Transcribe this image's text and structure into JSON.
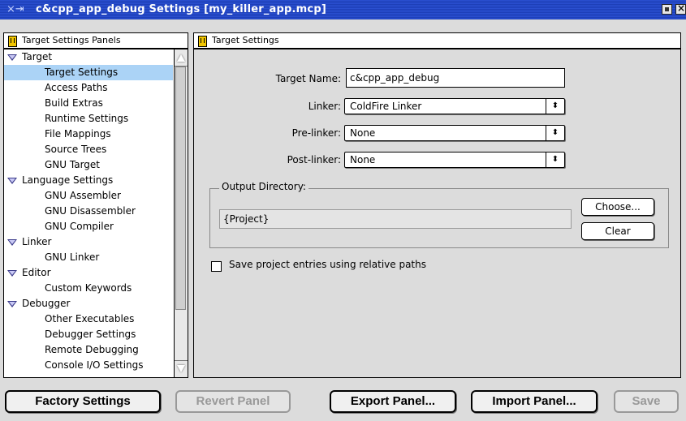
{
  "window": {
    "title": "c&cpp_app_debug Settings [my_killer_app.mcp]"
  },
  "left_panel": {
    "header": "Target Settings Panels",
    "tree": [
      {
        "label": "Target",
        "type": "group"
      },
      {
        "label": "Target Settings",
        "type": "item",
        "selected": true
      },
      {
        "label": "Access Paths",
        "type": "item"
      },
      {
        "label": "Build Extras",
        "type": "item"
      },
      {
        "label": "Runtime Settings",
        "type": "item"
      },
      {
        "label": "File Mappings",
        "type": "item"
      },
      {
        "label": "Source Trees",
        "type": "item"
      },
      {
        "label": "GNU Target",
        "type": "item"
      },
      {
        "label": "Language Settings",
        "type": "group"
      },
      {
        "label": "GNU Assembler",
        "type": "item"
      },
      {
        "label": "GNU Disassembler",
        "type": "item"
      },
      {
        "label": "GNU Compiler",
        "type": "item"
      },
      {
        "label": "Linker",
        "type": "group"
      },
      {
        "label": "GNU Linker",
        "type": "item"
      },
      {
        "label": "Editor",
        "type": "group"
      },
      {
        "label": "Custom Keywords",
        "type": "item"
      },
      {
        "label": "Debugger",
        "type": "group"
      },
      {
        "label": "Other Executables",
        "type": "item"
      },
      {
        "label": "Debugger Settings",
        "type": "item"
      },
      {
        "label": "Remote Debugging",
        "type": "item"
      },
      {
        "label": "Console I/O Settings",
        "type": "item"
      }
    ]
  },
  "right_panel": {
    "header": "Target Settings",
    "target_name_label": "Target Name:",
    "target_name_value": "c&cpp_app_debug",
    "linker_label": "Linker:",
    "linker_value": "ColdFire Linker",
    "prelinker_label": "Pre-linker:",
    "prelinker_value": "None",
    "postlinker_label": "Post-linker:",
    "postlinker_value": "None",
    "output_dir_title": "Output Directory:",
    "output_dir_value": "{Project}",
    "choose_label": "Choose...",
    "clear_label": "Clear",
    "save_relative_label": "Save project entries using relative paths",
    "save_relative_checked": false
  },
  "buttons": {
    "factory": "Factory Settings",
    "revert": "Revert Panel",
    "export": "Export Panel...",
    "import": "Import Panel...",
    "save": "Save"
  },
  "colors": {
    "titlebar": "#2a4fd0",
    "selection": "#abd3f6"
  }
}
